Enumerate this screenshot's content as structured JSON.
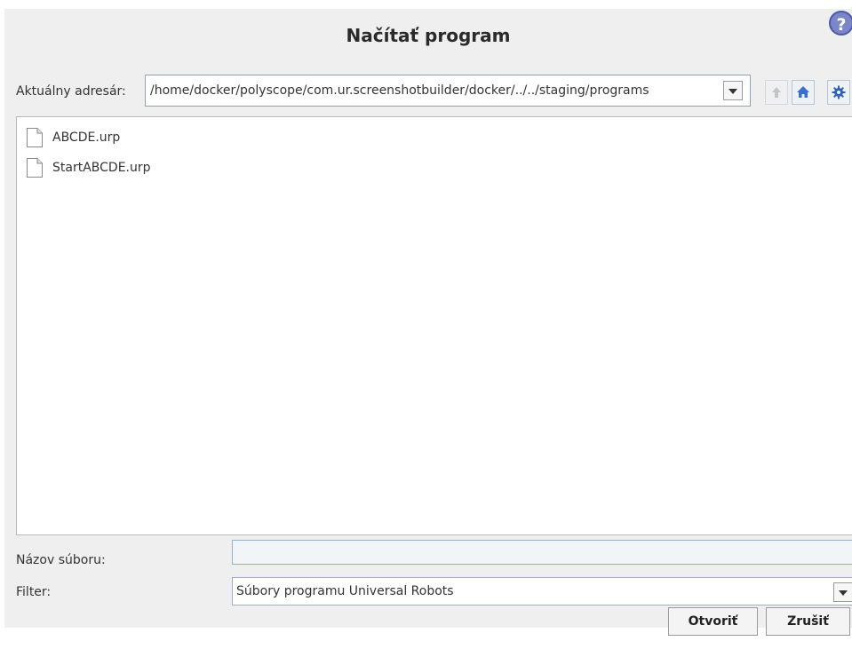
{
  "dialog": {
    "title": "Načítať program",
    "help_icon": "help-icon",
    "help_symbol": "?"
  },
  "directory": {
    "label": "Aktuálny adresár:",
    "path": "/home/docker/polyscope/com.ur.screenshotbuilder/docker/../../staging/programs",
    "dropdown_icon": "chevron-down-icon"
  },
  "toolbar": {
    "up_icon": "arrow-up-icon",
    "home_icon": "home-icon",
    "settings_icon": "gear-icon"
  },
  "files": [
    {
      "name": "ABCDE.urp",
      "icon": "file-icon"
    },
    {
      "name": "StartABCDE.urp",
      "icon": "file-icon"
    }
  ],
  "filename": {
    "label": "Názov súboru:",
    "value": ""
  },
  "filter": {
    "label": "Filter:",
    "selected": "Súbory programu Universal Robots"
  },
  "buttons": {
    "open_label": "Otvoriť",
    "cancel_label": "Zrušiť"
  },
  "colors": {
    "help_fill": "#7a86c8",
    "home_icon": "#3b6fcf",
    "settings_icon": "#2f5fb8"
  }
}
